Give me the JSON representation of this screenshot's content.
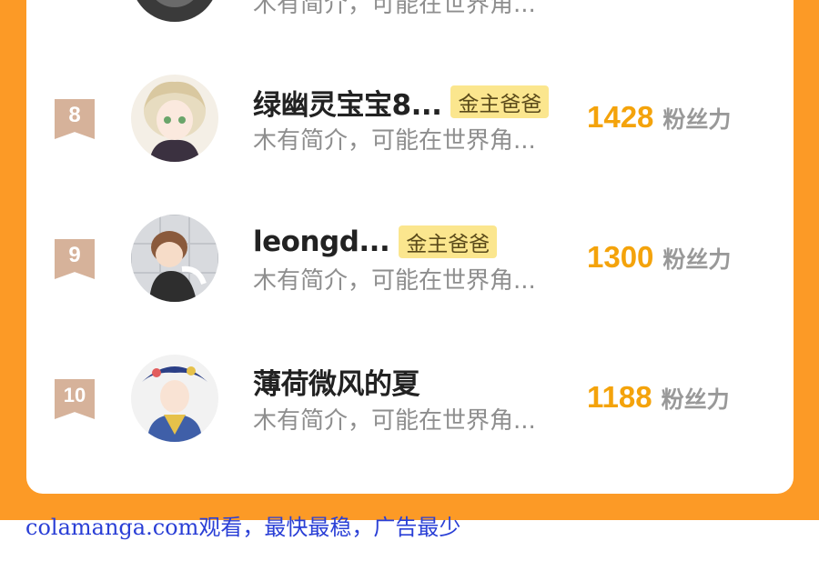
{
  "colors": {
    "frame": "#fc9a26",
    "rank_badge": "#d6b29a",
    "score": "#f4a30b",
    "vip_badge": "#fbe68e",
    "watermark": "#2a3fd6"
  },
  "top_partial": {
    "intro": "木有简介，可能在世界角..."
  },
  "fans": [
    {
      "rank": "8",
      "name": "绿幽灵宝宝8...",
      "badge": "金主爸爸",
      "intro": "木有简介，可能在世界角...",
      "score": "1428",
      "unit": "粉丝力"
    },
    {
      "rank": "9",
      "name": "leongd...",
      "badge": "金主爸爸",
      "intro": "木有简介，可能在世界角...",
      "score": "1300",
      "unit": "粉丝力"
    },
    {
      "rank": "10",
      "name": "薄荷微风的夏",
      "intro": "木有简介，可能在世界角...",
      "score": "1188",
      "unit": "粉丝力"
    }
  ],
  "watermark": "colamanga.com观看，最快最稳，广告最少"
}
